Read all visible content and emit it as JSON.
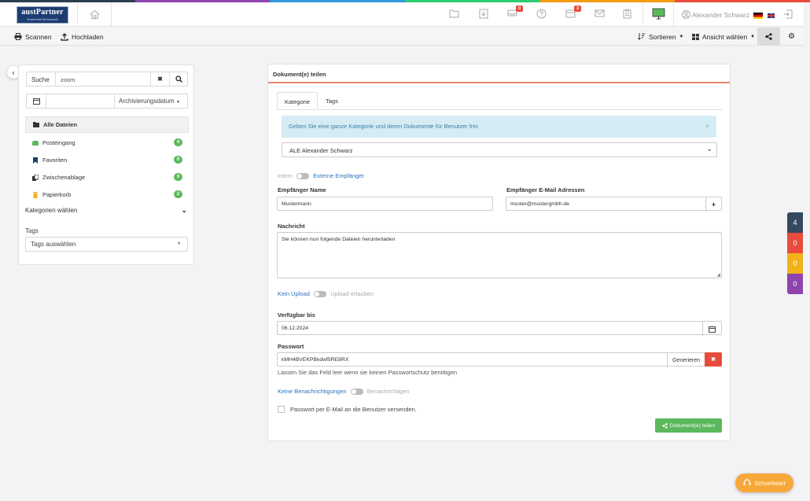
{
  "brand": {
    "line1": "austPartner",
    "line2": "Steuerberater Rechtsanwalt"
  },
  "stripe_colors": [
    "#2c3e50",
    "#8e44ad",
    "#3498db",
    "#2ecc71",
    "#f39c12",
    "#e74c3c"
  ],
  "topbar": {
    "user_name": "Alexander Schwarz",
    "badge_1": "0",
    "badge_2": "3"
  },
  "toolbar": {
    "scan_label": "Scannen",
    "upload_label": "Hochladen",
    "sort_label": "Sortieren",
    "view_label": "Ansicht wählen"
  },
  "left": {
    "search_label": "Suche",
    "search_value": "zoom",
    "date_sort_label": "Archivierungsdatum",
    "all_files": "Alle Dateien",
    "items": [
      {
        "label": "Posteingang",
        "count": "4",
        "icon": "inbox-icon"
      },
      {
        "label": "Favoriten",
        "count": "0",
        "icon": "bookmark-icon"
      },
      {
        "label": "Zwischenablage",
        "count": "0",
        "icon": "clipboard-icon"
      },
      {
        "label": "Papierkorb",
        "count": "2",
        "icon": "trash-icon"
      }
    ],
    "categories_label": "Kategorien wählen",
    "tags_label": "Tags",
    "tags_placeholder": "Tags auswählen"
  },
  "panel": {
    "title": "Dokument(e) teilen",
    "tab_category": "Kategorie",
    "tab_tags": "Tags",
    "info": "Geben Sie eine ganze Kategorie und deren Dokumente für Benutzer frei.",
    "category_select": "ALE Alexander Schwarz",
    "toggle_intern": "Intern",
    "toggle_extern": "Externe Empfänger",
    "recipient_name_label": "Empfänger Name",
    "recipient_name_value": "Mustermann",
    "recipient_email_label": "Empfänger E-Mail Adressen",
    "recipient_email_value": "muster@mustergmbh.de",
    "message_label": "Nachricht",
    "message_value": "Sie können nun folgende Dateien herunterladen",
    "upload_no": "Kein Upload",
    "upload_yes": "Upload erlauben",
    "available_label": "Verfügbar bis",
    "available_value": "06.12.2024",
    "password_label": "Passwort",
    "password_value": "kMH4BVEKPBkdwf5RE8RX",
    "generate_label": "Generieren",
    "password_hint": "Lassen Sie das Feld leer wenn sie keinen Passwortschutz benötigen",
    "notify_no": "Keine Benachrichtigungen",
    "notify_yes": "Benachrichtigen",
    "send_pw_label": "Passwort per E-Mail an die Benutzer versenden.",
    "share_button": "Dokument(e) teilen"
  },
  "side_counters": [
    {
      "value": "4",
      "color": "#34495e"
    },
    {
      "value": "0",
      "color": "#e74c3c"
    },
    {
      "value": "0",
      "color": "#f1b21a"
    },
    {
      "value": "0",
      "color": "#8e44ad"
    }
  ],
  "quickstart_label": "Schnellstart"
}
